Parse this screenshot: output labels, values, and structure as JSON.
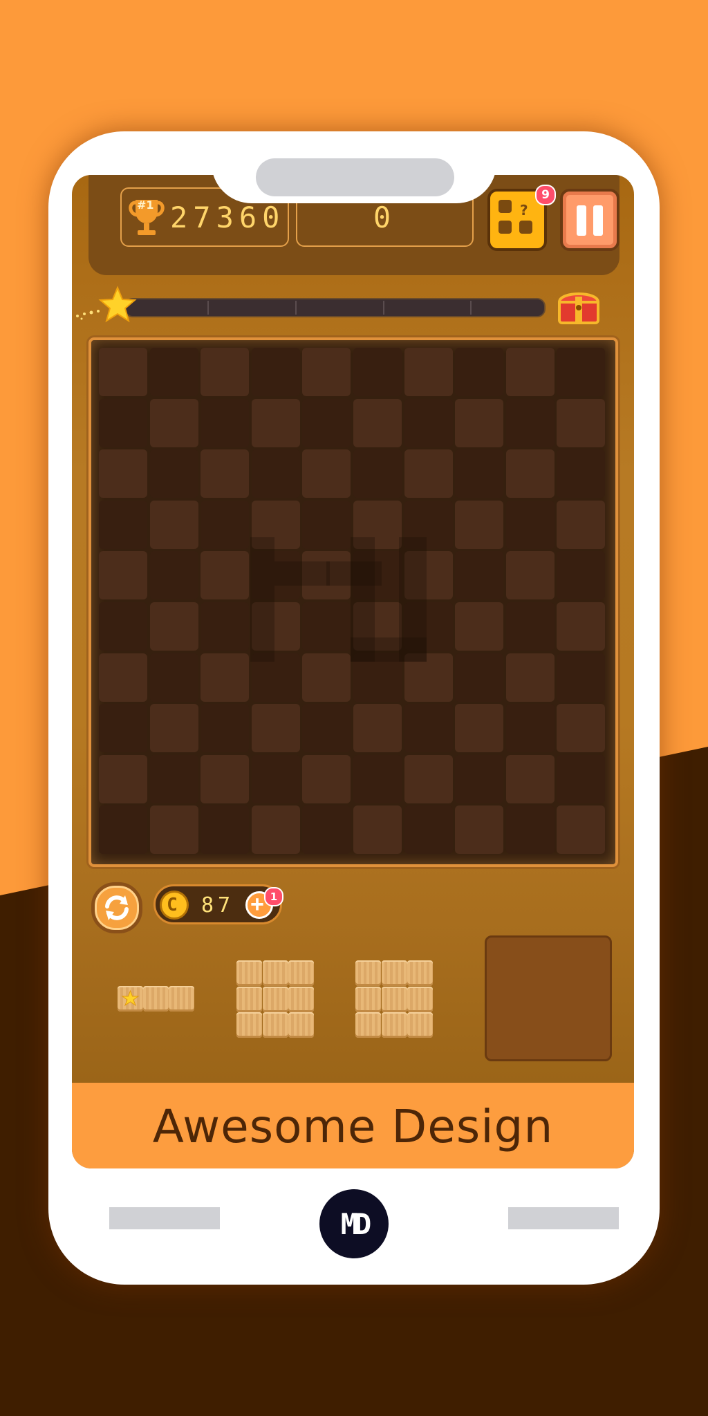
{
  "hud": {
    "best_rank": "#1",
    "best_score": "27360",
    "current_score": "0",
    "mystery_badge": "9",
    "mystery_symbol": "?"
  },
  "progress": {
    "value": 0,
    "icons": [
      "star-icon",
      "treasure-chest-icon"
    ]
  },
  "board": {
    "rows": 10,
    "cols": 10,
    "filled_cells": 0
  },
  "coins": {
    "symbol": "C",
    "amount": "87",
    "plus_badge": "1"
  },
  "pieces": [
    {
      "name": "piece-1x3-star",
      "shape": "1x3",
      "star": true
    },
    {
      "name": "piece-3x3-a",
      "shape": "3x3"
    },
    {
      "name": "piece-3x3-b",
      "shape": "3x3"
    }
  ],
  "footer": {
    "title": "Awesome Design"
  },
  "logo": {
    "text": "MD"
  },
  "colors": {
    "background_orange": "#fd9a3a",
    "background_brown": "#3f1e00",
    "score_text": "#ffd56a",
    "footer_band": "#fd9d3f"
  }
}
